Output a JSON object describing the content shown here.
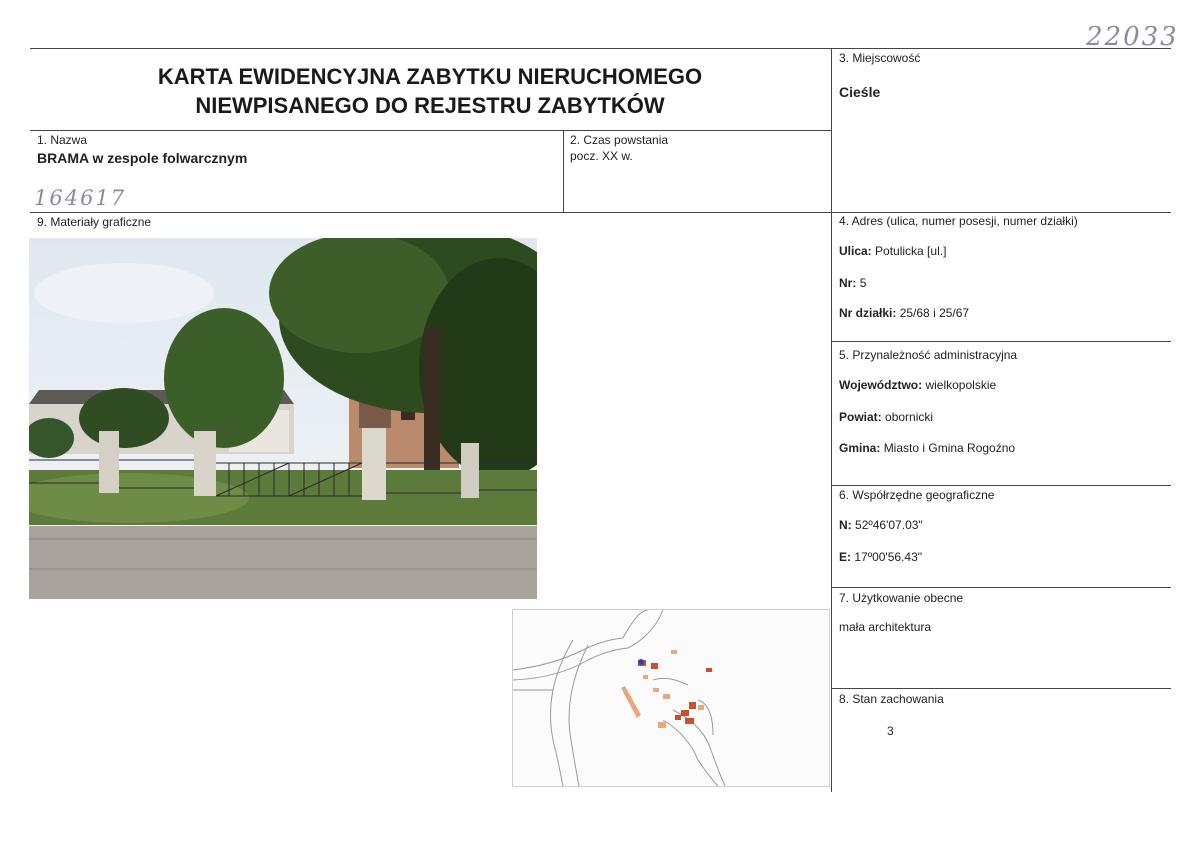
{
  "handwritten": {
    "top_right": "22033",
    "left_number": "164617"
  },
  "header": {
    "title_line1": "KARTA EWIDENCYJNA ZABYTKU NIERUCHOMEGO",
    "title_line2": "NIEWPISANEGO DO REJESTRU ZABYTKÓW"
  },
  "field1": {
    "label": "1. Nazwa",
    "value": "BRAMA w zespole folwarcznym"
  },
  "field2": {
    "label": "2. Czas powstania",
    "value": "pocz. XX w."
  },
  "field3": {
    "label": "3. Miejscowość",
    "value": "Cieśle"
  },
  "field4": {
    "label": "4. Adres (ulica, numer posesji, numer działki)",
    "street_key": "Ulica:",
    "street_value": "Potulicka [ul.]",
    "nr_key": "Nr:",
    "nr_value": "5",
    "plot_key": "Nr działki:",
    "plot_value": "25/68 i 25/67"
  },
  "field5": {
    "label": "5. Przynależność administracyjna",
    "voiv_key": "Województwo:",
    "voiv_value": "wielkopolskie",
    "powiat_key": "Powiat:",
    "powiat_value": "obornicki",
    "gmina_key": "Gmina:",
    "gmina_value": "Miasto i Gmina Rogoźno"
  },
  "field6": {
    "label": "6. Współrzędne geograficzne",
    "n_key": "N:",
    "n_value": "52º46'07.03\"",
    "e_key": "E:",
    "e_value": "17º00'56.43\""
  },
  "field7": {
    "label": "7. Użytkowanie obecne",
    "value": "mała architektura"
  },
  "field8": {
    "label": "8. Stan zachowania",
    "value": "3"
  },
  "field9": {
    "label": "9. Materiały graficzne"
  },
  "colors": {
    "rule": "#444444",
    "building": "#c8502a",
    "building_light": "#e8a878",
    "marker": "#2a3fd0"
  }
}
